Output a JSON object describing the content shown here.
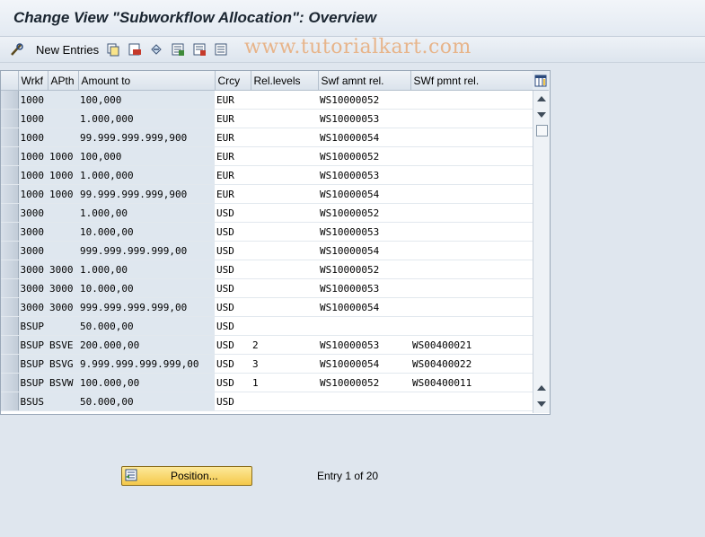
{
  "title": "Change View \"Subworkflow Allocation\": Overview",
  "toolbar": {
    "new_entries": "New Entries"
  },
  "watermark": "www.tutorialkart.com",
  "table": {
    "columns": [
      "Wrkf",
      "APth",
      "Amount to",
      "Crcy",
      "Rel.levels",
      "Swf amnt rel.",
      "SWf pmnt rel."
    ],
    "rows": [
      {
        "wrkf": "1000",
        "apth": "",
        "amount": "100,000",
        "crcy": "EUR",
        "rel": "",
        "swf": "WS10000052",
        "swp": ""
      },
      {
        "wrkf": "1000",
        "apth": "",
        "amount": "1.000,000",
        "crcy": "EUR",
        "rel": "",
        "swf": "WS10000053",
        "swp": ""
      },
      {
        "wrkf": "1000",
        "apth": "",
        "amount": "99.999.999.999,900",
        "crcy": "EUR",
        "rel": "",
        "swf": "WS10000054",
        "swp": ""
      },
      {
        "wrkf": "1000",
        "apth": "1000",
        "amount": "100,000",
        "crcy": "EUR",
        "rel": "",
        "swf": "WS10000052",
        "swp": ""
      },
      {
        "wrkf": "1000",
        "apth": "1000",
        "amount": "1.000,000",
        "crcy": "EUR",
        "rel": "",
        "swf": "WS10000053",
        "swp": ""
      },
      {
        "wrkf": "1000",
        "apth": "1000",
        "amount": "99.999.999.999,900",
        "crcy": "EUR",
        "rel": "",
        "swf": "WS10000054",
        "swp": ""
      },
      {
        "wrkf": "3000",
        "apth": "",
        "amount": "1.000,00",
        "crcy": "USD",
        "rel": "",
        "swf": "WS10000052",
        "swp": ""
      },
      {
        "wrkf": "3000",
        "apth": "",
        "amount": "10.000,00",
        "crcy": "USD",
        "rel": "",
        "swf": "WS10000053",
        "swp": ""
      },
      {
        "wrkf": "3000",
        "apth": "",
        "amount": "999.999.999.999,00",
        "crcy": "USD",
        "rel": "",
        "swf": "WS10000054",
        "swp": ""
      },
      {
        "wrkf": "3000",
        "apth": "3000",
        "amount": "1.000,00",
        "crcy": "USD",
        "rel": "",
        "swf": "WS10000052",
        "swp": ""
      },
      {
        "wrkf": "3000",
        "apth": "3000",
        "amount": "10.000,00",
        "crcy": "USD",
        "rel": "",
        "swf": "WS10000053",
        "swp": ""
      },
      {
        "wrkf": "3000",
        "apth": "3000",
        "amount": "999.999.999.999,00",
        "crcy": "USD",
        "rel": "",
        "swf": "WS10000054",
        "swp": ""
      },
      {
        "wrkf": "BSUP",
        "apth": "",
        "amount": "50.000,00",
        "crcy": "USD",
        "rel": "",
        "swf": "",
        "swp": ""
      },
      {
        "wrkf": "BSUP",
        "apth": "BSVE",
        "amount": "200.000,00",
        "crcy": "USD",
        "rel": "2",
        "swf": "WS10000053",
        "swp": "WS00400021"
      },
      {
        "wrkf": "BSUP",
        "apth": "BSVG",
        "amount": "9.999.999.999.999,00",
        "crcy": "USD",
        "rel": "3",
        "swf": "WS10000054",
        "swp": "WS00400022"
      },
      {
        "wrkf": "BSUP",
        "apth": "BSVW",
        "amount": "100.000,00",
        "crcy": "USD",
        "rel": "1",
        "swf": "WS10000052",
        "swp": "WS00400011"
      },
      {
        "wrkf": "BSUS",
        "apth": "",
        "amount": "50.000,00",
        "crcy": "USD",
        "rel": "",
        "swf": "",
        "swp": ""
      }
    ]
  },
  "footer": {
    "position_button": "Position...",
    "entry_info": "Entry 1 of 20"
  },
  "colors": {
    "button_yellow": "#f4c84a",
    "key_column_bg": "#dfe7ef",
    "watermark": "#e7b48a"
  }
}
